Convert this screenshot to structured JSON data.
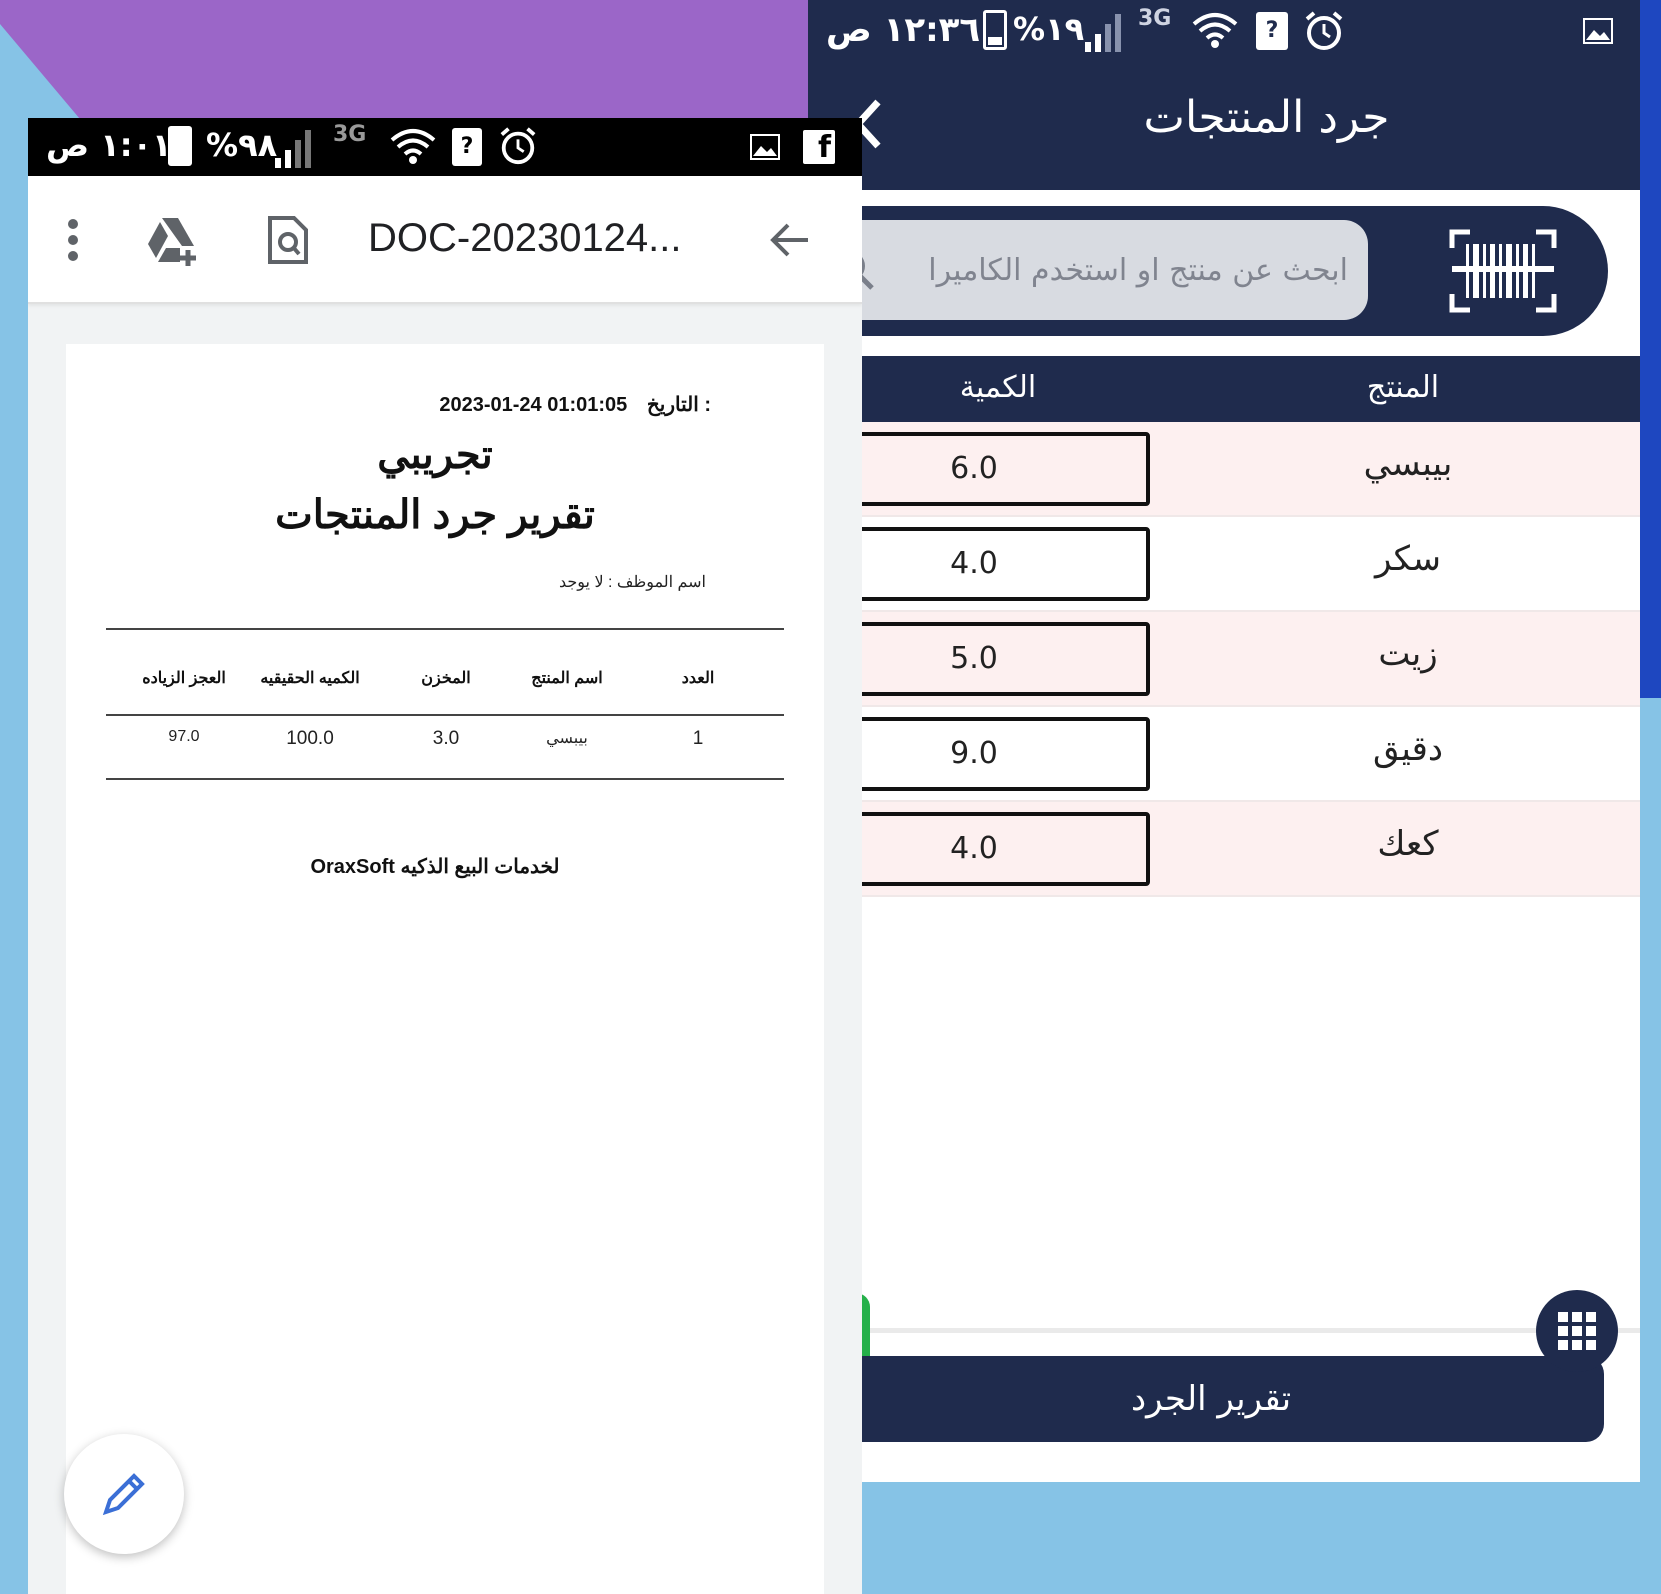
{
  "right_app": {
    "status": {
      "time": "١٢:٣٦ ص",
      "battery": "%١٩",
      "network": "3G",
      "sim": "?"
    },
    "title": "جرد المنتجات",
    "search": {
      "placeholder": "ابحث عن منتج او استخدم الكاميرا"
    },
    "table": {
      "col_product": "المنتج",
      "col_quantity": "الكمية",
      "rows": [
        {
          "product": "بيبسي",
          "quantity": "6.0"
        },
        {
          "product": "سكر",
          "quantity": "4.0"
        },
        {
          "product": "زيت",
          "quantity": "5.0"
        },
        {
          "product": "دقيق",
          "quantity": "9.0"
        },
        {
          "product": "كعك",
          "quantity": "4.0"
        }
      ]
    },
    "report_button": "تقرير الجرد",
    "colors": {
      "primary": "#1f2b4d",
      "row_alt": "#fdf0f0",
      "green": "#25b04a"
    }
  },
  "left_app": {
    "status": {
      "time": "١:٠١ ص",
      "battery": "%٩٨",
      "network": "3G",
      "sim": "?"
    },
    "title": "DOC-20230124...",
    "document": {
      "date_label": "التاريخ :",
      "date_value": "2023-01-24 01:01:05",
      "company": "تجريبي",
      "report_title": "تقرير جرد المنتجات",
      "employee": "اسم الموظف : لا يوجد",
      "headers": {
        "index": "العدد",
        "product_name": "اسم المنتج",
        "stock": "المخزن",
        "actual_qty": "الكميه الحقيقيه",
        "diff": "العجز الزياده"
      },
      "rows": [
        {
          "index": "1",
          "product_name": "بيبسي",
          "stock": "3.0",
          "actual_qty": "100.0",
          "diff": "97.0"
        }
      ],
      "footer": "OraxSoft لخدمات البيع الذكيه"
    }
  }
}
